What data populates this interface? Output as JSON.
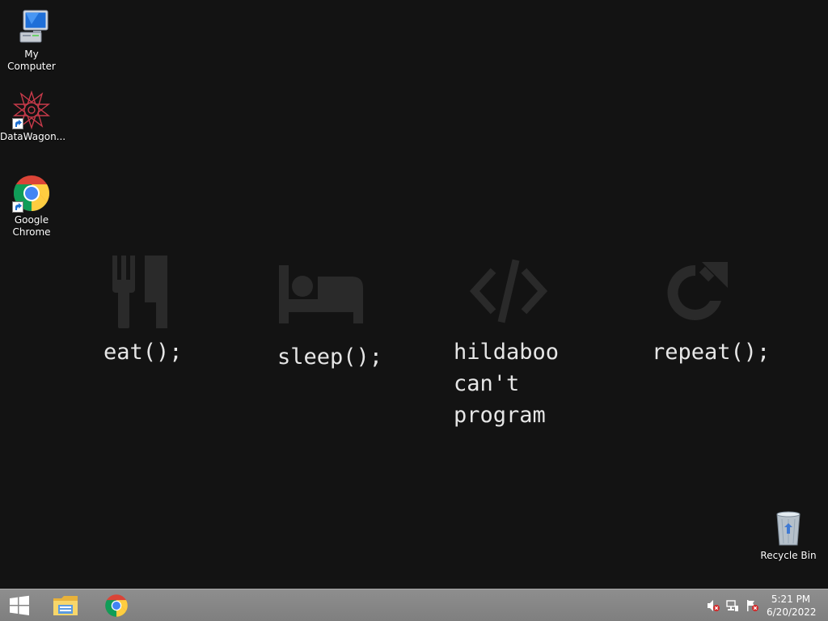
{
  "desktop": {
    "icons": [
      {
        "label": "My Computer",
        "icon": "computer-icon"
      },
      {
        "label": "DataWagon...",
        "icon": "datawagon-icon"
      },
      {
        "label": "Google\nChrome",
        "icon": "chrome-icon"
      },
      {
        "label": "Recycle Bin",
        "icon": "recycle-bin-icon"
      }
    ]
  },
  "wallpaper": {
    "items": [
      {
        "icon": "fork-knife-icon",
        "text": "eat();"
      },
      {
        "icon": "bed-icon",
        "text": "sleep();"
      },
      {
        "icon": "code-icon",
        "text": "hildaboo\ncan't\nprogram"
      },
      {
        "icon": "redo-icon",
        "text": "repeat();"
      }
    ]
  },
  "taskbar": {
    "buttons": [
      {
        "icon": "windows-start-icon"
      },
      {
        "icon": "file-explorer-icon"
      },
      {
        "icon": "chrome-icon"
      }
    ],
    "tray": [
      {
        "icon": "volume-muted-icon"
      },
      {
        "icon": "network-icon"
      },
      {
        "icon": "action-center-flag-icon"
      }
    ],
    "clock": {
      "time": "5:21 PM",
      "date": "6/20/2022"
    }
  },
  "colors": {
    "background": "#131313",
    "taskbar": "#868686",
    "wallpaper_icon": "#2a2a2a",
    "wallpaper_text": "#e6e6e6"
  }
}
